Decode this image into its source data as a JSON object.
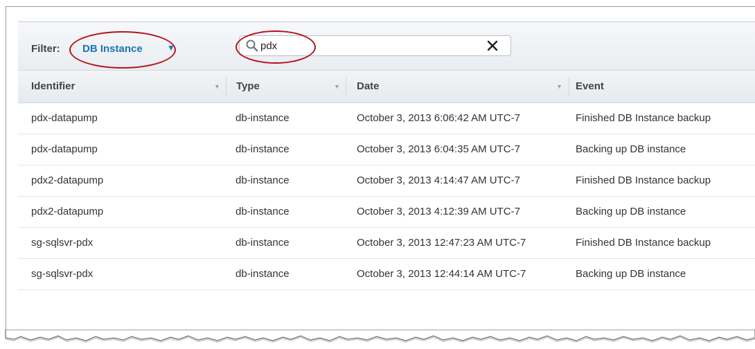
{
  "filter": {
    "label": "Filter:",
    "selected": "DB Instance"
  },
  "search": {
    "value": "pdx"
  },
  "table": {
    "columns": [
      "Identifier",
      "Type",
      "Date",
      "Event"
    ],
    "rows": [
      [
        "pdx-datapump",
        "db-instance",
        "October 3, 2013 6:06:42 AM UTC-7",
        "Finished DB Instance backup"
      ],
      [
        "pdx-datapump",
        "db-instance",
        "October 3, 2013 6:04:35 AM UTC-7",
        "Backing up DB instance"
      ],
      [
        "pdx2-datapump",
        "db-instance",
        "October 3, 2013 4:14:47 AM UTC-7",
        "Finished DB Instance backup"
      ],
      [
        "pdx2-datapump",
        "db-instance",
        "October 3, 2013 4:12:39 AM UTC-7",
        "Backing up DB instance"
      ],
      [
        "sg-sqlsvr-pdx",
        "db-instance",
        "October 3, 2013 12:47:23 AM UTC-7",
        "Finished DB Instance backup"
      ],
      [
        "sg-sqlsvr-pdx",
        "db-instance",
        "October 3, 2013 12:44:14 AM UTC-7",
        "Backing up DB instance"
      ]
    ]
  },
  "colors": {
    "highlight": "#b5121b",
    "link": "#1a73b7"
  }
}
